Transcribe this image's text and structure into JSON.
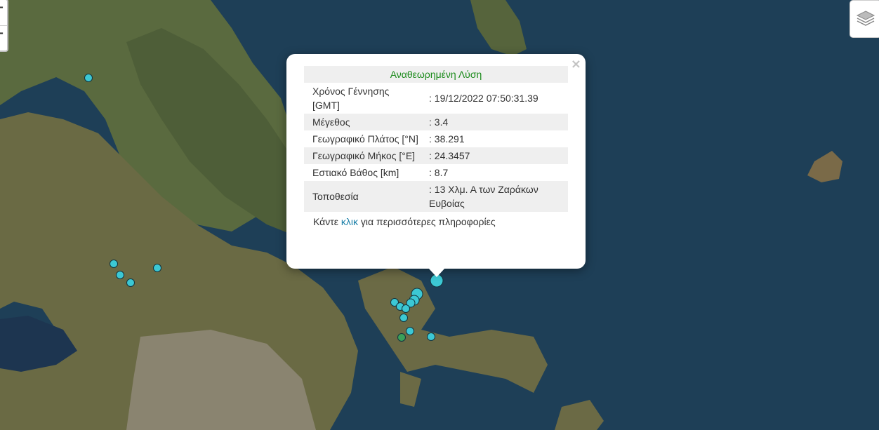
{
  "popup": {
    "header": "Αναθεωρημένη Λύση",
    "close_label": "×",
    "rows": [
      {
        "label": "Χρόνος Γέννησης [GMT]",
        "value": ": 19/12/2022 07:50:31.39"
      },
      {
        "label": "Μέγεθος",
        "value": ": 3.4"
      },
      {
        "label": "Γεωγραφικό Πλάτος [°N]",
        "value": ": 38.291"
      },
      {
        "label": "Γεωγραφικό Μήκος [°E]",
        "value": ": 24.3457"
      },
      {
        "label": "Εστιακό Βάθος [km]",
        "value": ": 8.7"
      },
      {
        "label": "Τοποθεσία",
        "value": ": 13 Χλμ. Α των Ζαράκων Ευβοίας"
      }
    ],
    "more_prefix": "Κάντε ",
    "more_link": "κλικ",
    "more_suffix": " για περισσότερες πληροφορίες"
  },
  "map_controls": {
    "zoom_in": "+",
    "zoom_out": "−",
    "layers_icon": "layers-icon"
  },
  "colors": {
    "marker": "#3cc8d4",
    "marker_green": "#3aa05a",
    "text_header": "#1a8a1a",
    "link": "#1a7fa8"
  }
}
